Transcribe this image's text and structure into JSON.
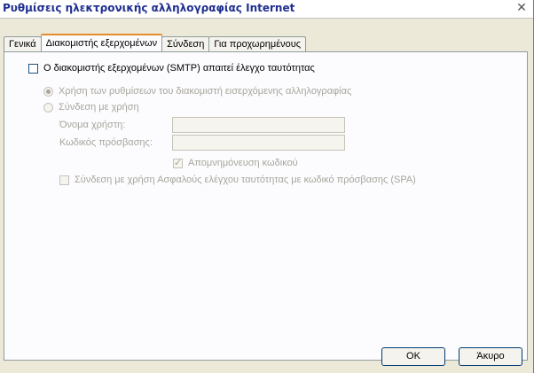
{
  "window": {
    "title": "Ρυθμίσεις ηλεκτρονικής αλληλογραφίας Internet",
    "close_glyph": "✕"
  },
  "tabs": [
    {
      "label": "Γενικά"
    },
    {
      "label": "Διακομιστής εξερχομένων",
      "active": true
    },
    {
      "label": "Σύνδεση"
    },
    {
      "label": "Για προχωρημένους"
    }
  ],
  "panel": {
    "smtp_auth_checkbox": {
      "label": "Ο διακομιστής εξερχομένων (SMTP) απαιτεί έλεγχο ταυτότητας",
      "checked": false
    },
    "radio_use_incoming": {
      "label": "Χρήση των ρυθμίσεων του διακομιστή εισερχόμενης αλληλογραφίας",
      "checked": true
    },
    "radio_login_with": {
      "label": "Σύνδεση με χρήση",
      "checked": false
    },
    "username": {
      "label": "Όνομα χρήστη:",
      "value": ""
    },
    "password": {
      "label": "Κωδικός πρόσβασης:",
      "value": ""
    },
    "remember_password": {
      "label": "Απομνημόνευση κωδικού",
      "checked": true
    },
    "spa_checkbox": {
      "label": "Σύνδεση με χρήση Ασφαλούς ελέγχου ταυτότητας με κωδικό πρόσβασης (SPA)",
      "checked": false
    }
  },
  "buttons": {
    "ok": "OK",
    "cancel": "Άκυρο"
  },
  "colors": {
    "title_text": "#1f2f8f",
    "dialog_bg": "#ece9d8",
    "panel_bg": "#fcfcfe",
    "active_tab_accent": "#e68b2c",
    "disabled_text": "#a7a59c"
  }
}
